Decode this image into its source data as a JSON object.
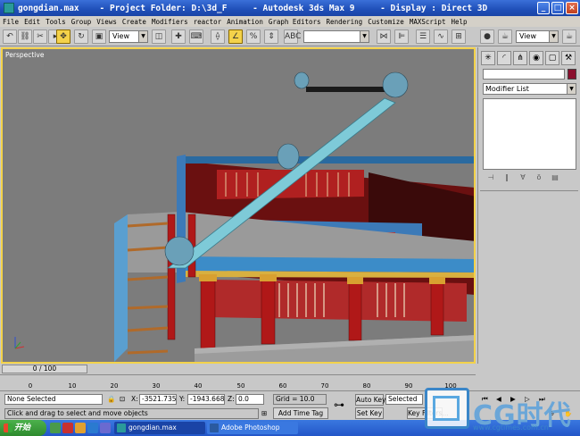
{
  "window": {
    "title": "gongdian.max    - Project Folder: D:\\3d_F     - Autodesk 3ds Max 9     - Display : Direct 3D",
    "buttons": [
      "_",
      "□",
      "×"
    ]
  },
  "menu": [
    "File",
    "Edit",
    "Tools",
    "Group",
    "Views",
    "Create",
    "Modifiers",
    "reactor",
    "Animation",
    "Graph Editors",
    "Rendering",
    "Customize",
    "MAXScript",
    "Help"
  ],
  "toolbar": {
    "view_combo_1": "View",
    "view_combo_2": "View",
    "selection_set": ""
  },
  "viewport": {
    "label": "Perspective",
    "border_color": "#f3d24a"
  },
  "command_panel": {
    "modifier_list": "Modifier List",
    "object_color": "#8a0f2e"
  },
  "timeline": {
    "slider_label": "0 / 100",
    "ticks": [
      "0",
      "10",
      "20",
      "30",
      "40",
      "50",
      "60",
      "70",
      "80",
      "90",
      "100"
    ]
  },
  "status": {
    "selection": "None Selected",
    "prompt": "Click and drag to select and move objects",
    "x_label": "X:",
    "x_value": "-3521.735",
    "y_label": "Y:",
    "y_value": "-1943.668",
    "z_label": "Z:",
    "z_value": "0.0",
    "grid": "Grid = 10.0",
    "add_time_tag": "Add Time Tag",
    "auto_key": "Auto Key",
    "auto_key_value": "Selected",
    "set_key": "Set Key",
    "key_filters": "Key Filters..."
  },
  "taskbar": {
    "start": "开始",
    "tasks": [
      "gongdian.max",
      "Adobe Photoshop"
    ]
  },
  "watermark": {
    "text": "CG时代",
    "url": "www.cgtimes.com.cn"
  }
}
